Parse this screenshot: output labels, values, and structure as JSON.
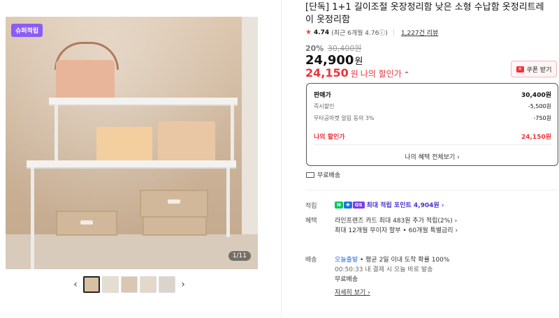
{
  "gallery": {
    "badge": "슈퍼적립",
    "counter": "1/11",
    "prev": "‹",
    "next": "›",
    "thumbnails": [
      "thumb-1",
      "thumb-2",
      "thumb-3",
      "thumb-4",
      "thumb-5"
    ]
  },
  "product": {
    "title": "[단독] 1+1 길이조절 옷장정리함 낮은 소형 수납함 옷정리트레이 옷정리함",
    "rating": "4.74",
    "rating_note": "(최근 6개월 4.76ⓘ)",
    "reviews": "1,227건 리뷰",
    "discount_pct": "20%",
    "original_price": "30,400원",
    "price": "24,900",
    "price_unit": "원",
    "my_price": "24,150",
    "my_price_unit": "원",
    "my_price_label": "나의 할인가",
    "my_price_caret": "⌃",
    "coupon_button": "쿠폰 받기"
  },
  "breakdown": {
    "rows": [
      {
        "label": "판매가",
        "amount": "30,400원"
      },
      {
        "label": "즉시할인",
        "amount": "-5,500원"
      },
      {
        "label": "무타공마켓 알림 동의 3%",
        "amount": "-750원"
      }
    ],
    "mine_label": "나의 할인가",
    "mine_amount": "24,150원",
    "all_benefits": "나의 혜택 전체보기 ›"
  },
  "shipping_free": "무료배송",
  "points": {
    "label": "적립",
    "badge1": "N",
    "badge2": "✚",
    "badge3": "GS",
    "text": "최대 적립 포인트 4,904원 ›"
  },
  "benefits": {
    "label": "혜택",
    "line1": "라인프렌즈 카드 최대 483원 추가 적립(2%) ›",
    "line2": "최대 12개월 무이자 할부 • 60개월 특별금리 ›"
  },
  "delivery": {
    "label": "배송",
    "today": "오늘출발",
    "note": " • 평균 2일 이내 도착 확률 100%",
    "time": "00:50:33  내 결제 시 오늘 바로 발송",
    "free": "무료배송",
    "details": "자세히 보기 ›"
  },
  "colors": {
    "accent_red": "#f0323c",
    "point_purple": "#4a2fd1",
    "badge_purple": "#8b5cf6",
    "delivery_blue": "#2563eb"
  }
}
